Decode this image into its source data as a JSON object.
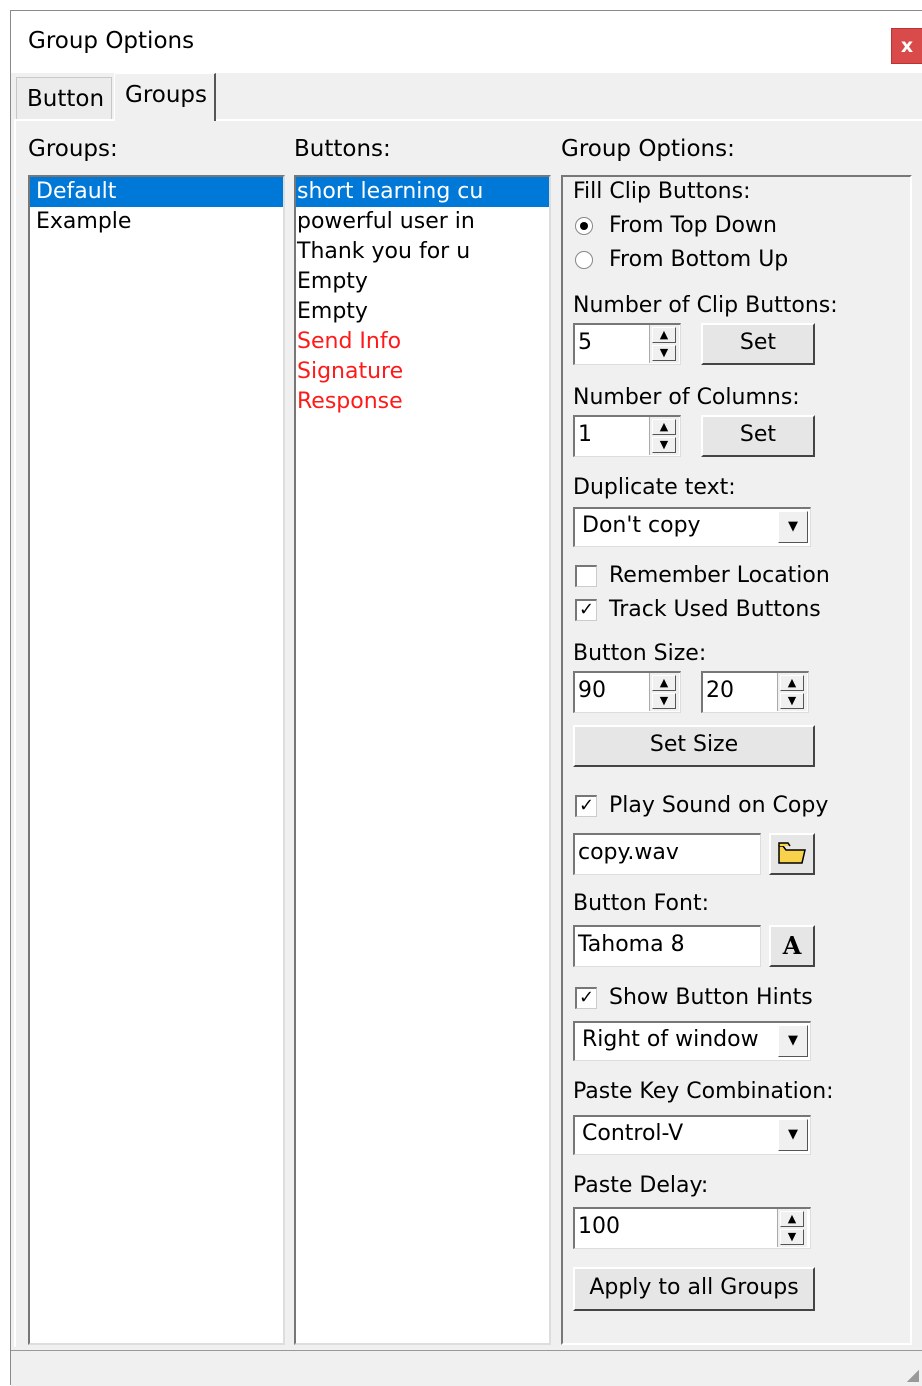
{
  "window": {
    "title": "Group Options",
    "close": "x"
  },
  "tabs": [
    {
      "label": "Button"
    },
    {
      "label": "Groups"
    }
  ],
  "groups": {
    "label": "Groups:",
    "items": [
      "Default",
      "Example"
    ]
  },
  "buttons": {
    "label": "Buttons:",
    "items": [
      "short learning cu",
      "powerful user in",
      "Thank you for u",
      "Empty",
      "Empty",
      "Send Info",
      "Signature",
      "Response"
    ]
  },
  "options": {
    "label": "Group Options:",
    "fill_label": "Fill Clip Buttons:",
    "fill_top": "From Top Down",
    "fill_bottom": "From Bottom Up",
    "num_buttons_label": "Number of Clip Buttons:",
    "num_buttons": "5",
    "set_label": "Set",
    "num_columns_label": "Number of Columns:",
    "num_columns": "1",
    "dup_label": "Duplicate text:",
    "dup_value": "Don't copy",
    "remember_location": "Remember Location",
    "track_used": "Track Used Buttons",
    "size_label": "Button Size:",
    "size_w": "90",
    "size_h": "20",
    "set_size": "Set Size",
    "play_sound": "Play Sound on Copy",
    "sound_file": "copy.wav",
    "font_label": "Button Font:",
    "font_value": "Tahoma 8",
    "font_btn": "A",
    "show_hints": "Show Button Hints",
    "hints_position": "Right of window",
    "paste_key_label": "Paste Key Combination:",
    "paste_key": "Control-V",
    "delay_label": "Paste Delay:",
    "delay_value": "100",
    "apply_all": "Apply to all Groups",
    "check_mark": "✓"
  },
  "icons": {
    "folder": "folder-icon",
    "font": "font-icon"
  },
  "colors": {
    "selection": "#0078d7",
    "missing_item": "#ff1a1a",
    "close": "#d94b4b"
  }
}
